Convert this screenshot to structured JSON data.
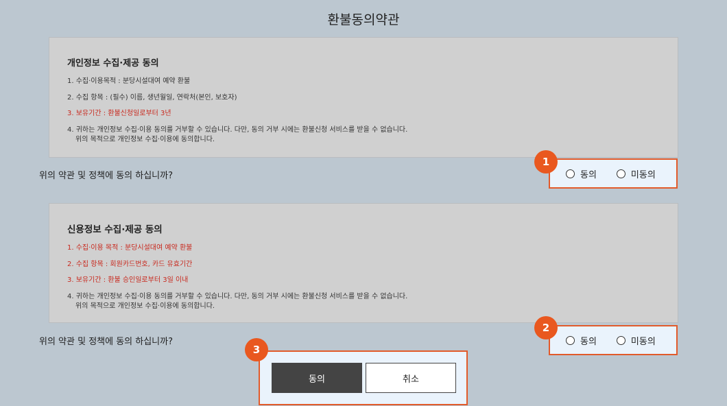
{
  "page": {
    "title": "환불동의약관"
  },
  "section1": {
    "heading": "개인정보 수집·제공 동의",
    "items": [
      "1. 수집·이용목적 : 분당시설대여 예약 환불",
      "2. 수집 항목 : (필수) 이름, 생년월일, 연락처(본인, 보호자)",
      "3. 보유기간 : 환불신청일로부터 3년",
      "4. 귀하는 개인정보 수집·이용 동의를 거부할 수 있습니다. 다만, 동의 거부 시에는 환불신청 서비스를 받을 수 없습니다."
    ],
    "item4_cont": "위의 목적으로 개인정보 수집·이용에 동의합니다.",
    "question": "위의 약관 및 정책에 동의 하십니까?",
    "agree_label": "동의",
    "disagree_label": "미동의",
    "badge": "1"
  },
  "section2": {
    "heading": "신용정보 수집·제공 동의",
    "items": [
      "1. 수집·이용 목적 : 분당시설대여 예약 환불",
      "2. 수집 항목 : 회원카드번호, 카드 유효기간",
      "3. 보유기간 : 환불 승인일로부터 3일 이내",
      "4. 귀하는 개인정보 수집·이용 동의를 거부할 수 있습니다. 다만, 동의 거부 시에는 환불신청 서비스를 받을 수 없습니다."
    ],
    "item4_cont": "위의 목적으로 개인정보 수집·이용에 동의합니다.",
    "question": "위의 약관 및 정책에 동의 하십니까?",
    "agree_label": "동의",
    "disagree_label": "미동의",
    "badge": "2"
  },
  "actions": {
    "agree_button": "동의",
    "cancel_button": "취소",
    "badge": "3"
  },
  "colors": {
    "highlight_border": "#e25a2a",
    "badge": "#e9581f",
    "red_text": "#c8291e",
    "primary_button": "#444444"
  }
}
